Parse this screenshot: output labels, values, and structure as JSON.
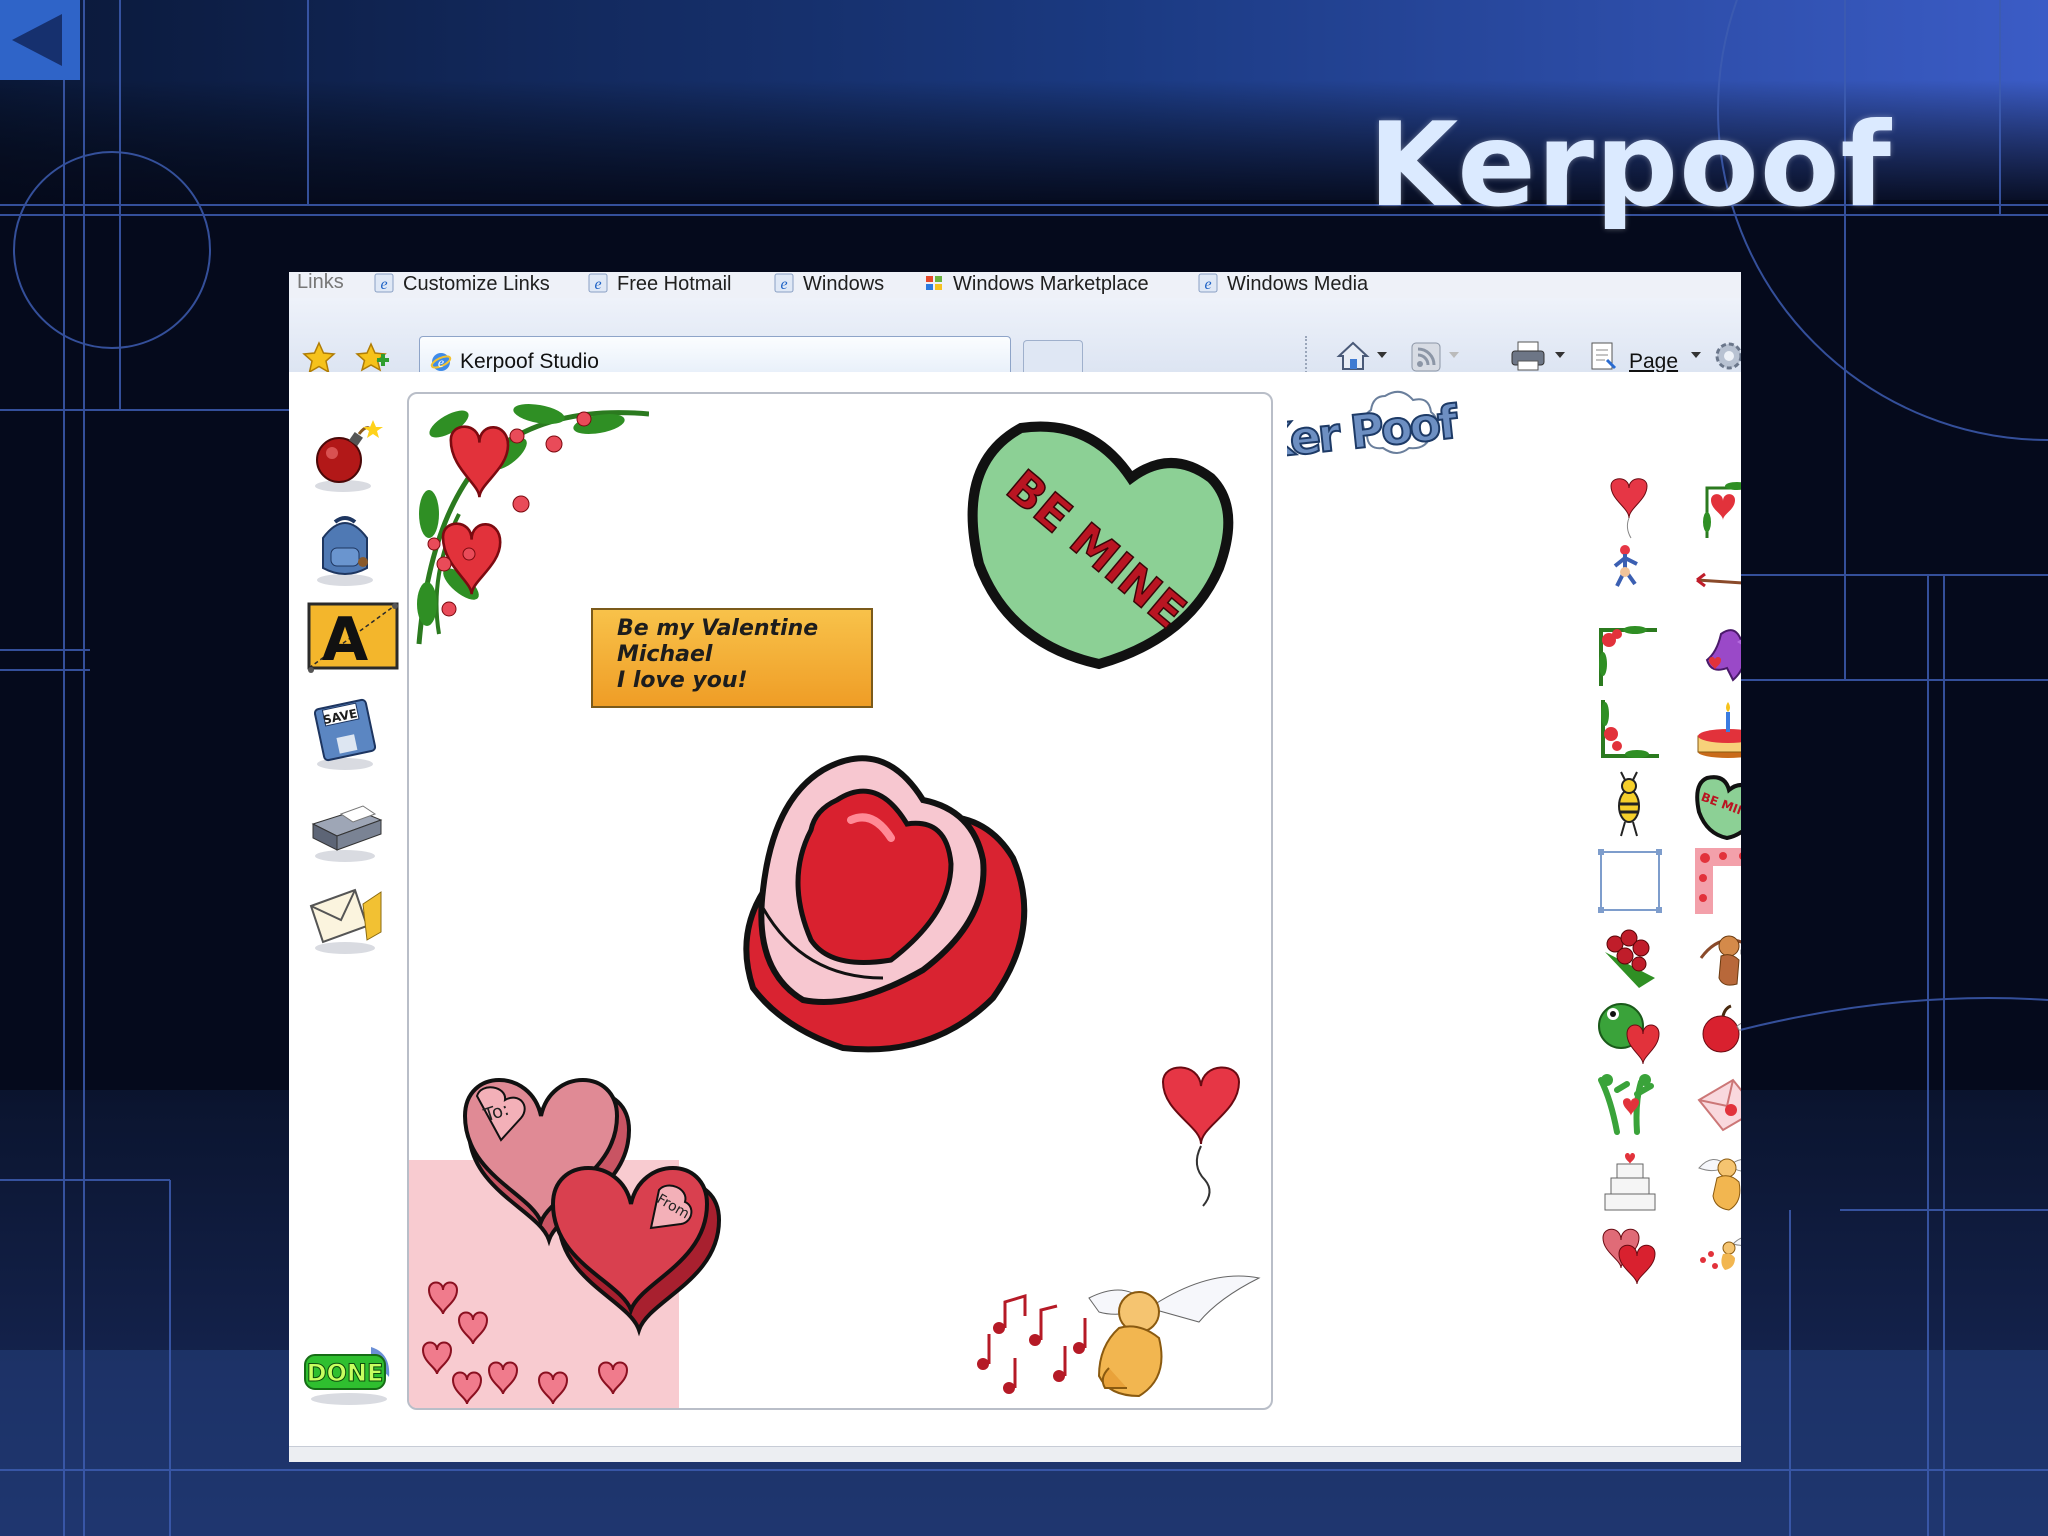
{
  "slide": {
    "title": "Kerpoof"
  },
  "browser": {
    "links_bar": {
      "label": "Links",
      "items": [
        "Customize Links",
        "Free Hotmail",
        "Windows",
        "Windows Marketplace",
        "Windows Media"
      ]
    },
    "tab": {
      "title": "Kerpoof Studio"
    },
    "toolbar": {
      "page_label": "Page"
    }
  },
  "app": {
    "logo": "Ker Poof",
    "tools": [
      "bomb-icon",
      "backpack-icon",
      "text-tool-icon",
      "save-icon",
      "printer-icon",
      "envelope-icon"
    ],
    "save_badge": "SAVE",
    "done_button": "DONE",
    "canvas": {
      "note_lines": [
        "Be my Valentine",
        "Michael",
        "I love you!"
      ],
      "candy_heart_text": "BE MINE",
      "box_lid_text": "To:",
      "box_tag_text": "From:"
    },
    "palette_mini_heart_text": "BE MINE"
  }
}
